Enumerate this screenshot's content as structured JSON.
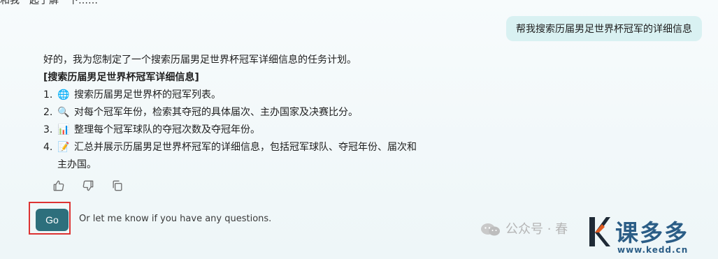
{
  "clipped_header": {
    "text": "和我一起了解一下……"
  },
  "user_message": {
    "text": "帮我搜索历届男足世界杯冠军的详细信息"
  },
  "assistant": {
    "intro": "好的，我为您制定了一个搜索历届男足世界杯冠军详细信息的任务计划。",
    "plan_title": "[搜索历届男足世界杯冠军详细信息]",
    "steps": [
      {
        "num": "1.",
        "emoji": "🌐",
        "text": "搜索历届男足世界杯的冠军列表。"
      },
      {
        "num": "2.",
        "emoji": "🔍",
        "text": "对每个冠军年份，检索其夺冠的具体届次、主办国家及决赛比分。"
      },
      {
        "num": "3.",
        "emoji": "📊",
        "text": "整理每个冠军球队的夺冠次数及夺冠年份。"
      },
      {
        "num": "4.",
        "emoji": "📝",
        "text": "汇总并展示历届男足世界杯冠军的详细信息，包括冠军球队、夺冠年份、届次和",
        "text_continued": "主办国。"
      }
    ]
  },
  "feedback": {
    "icons": [
      "thumbs-up-icon",
      "thumbs-down-icon",
      "copy-icon"
    ]
  },
  "go": {
    "label": "Go",
    "hint": "Or let me know if you have any questions."
  },
  "watermark": {
    "wechat_label": "公众号 · 春",
    "brand": "课多多",
    "url": "www.kedd.cn",
    "brand_color": "#2b5d86",
    "accent_color": "#e05a1f"
  },
  "colors": {
    "user_bubble_bg": "#d9f1f2",
    "go_button_bg": "#2d6f7c",
    "highlight_border": "#d33333"
  }
}
